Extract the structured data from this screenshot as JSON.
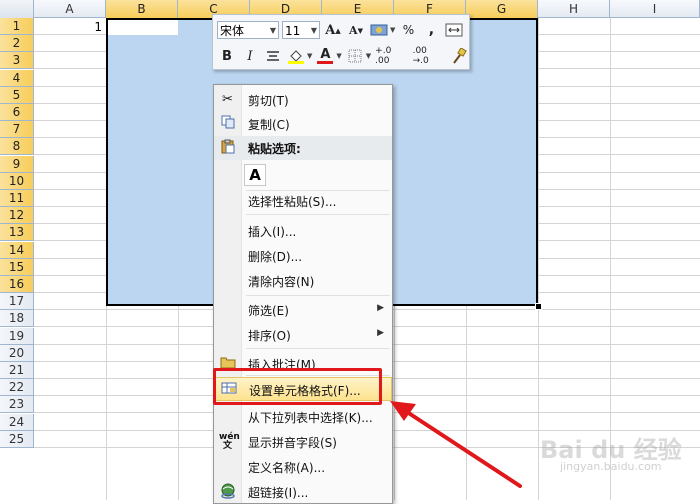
{
  "columns": [
    "A",
    "B",
    "C",
    "D",
    "E",
    "F",
    "G",
    "H",
    "I"
  ],
  "rows": [
    "1",
    "2",
    "3",
    "4",
    "5",
    "6",
    "7",
    "8",
    "9",
    "10",
    "11",
    "12",
    "13",
    "14",
    "15",
    "16",
    "17",
    "18",
    "19",
    "20",
    "21",
    "22",
    "23",
    "24",
    "25"
  ],
  "cell_a1_value": "1",
  "mini_toolbar": {
    "font_name": "宋体",
    "font_size": "11",
    "grow_font": "A",
    "shrink_font": "A",
    "percent": "%",
    "comma": ",",
    "bold": "B",
    "italic": "I",
    "font_color_letter": "A",
    "increase_decimal": "+.0 .00",
    "decrease_decimal": ".00 →.0"
  },
  "context_menu": {
    "cut": "剪切(T)",
    "copy": "复制(C)",
    "paste_options": "粘贴选项:",
    "paste_a": "A",
    "paste_special": "选择性粘贴(S)...",
    "insert": "插入(I)...",
    "delete": "删除(D)...",
    "clear": "清除内容(N)",
    "filter": "筛选(E)",
    "sort": "排序(O)",
    "insert_comment": "插入批注(M)",
    "format_cells": "设置单元格格式(F)...",
    "pick_from_list": "从下拉列表中选择(K)...",
    "phonetic": "显示拼音字段(S)",
    "define_name": "定义名称(A)...",
    "hyperlink": "超链接(I)..."
  },
  "icons": {
    "cut": "scissors-icon",
    "copy": "copy-icon",
    "paste": "clipboard-icon",
    "comment": "comment-folder-icon",
    "format": "format-cells-icon",
    "phonetic": "wen-phonetic-icon",
    "hyperlink": "globe-link-icon"
  },
  "watermark": "Bai du 经验",
  "watermark_sub": "jingyan.baidu.com",
  "colors": {
    "selection": "#bcd6f1",
    "header_selected": "#f7cd5a",
    "highlight_box": "#e0171b",
    "arrow": "#e0171b"
  }
}
